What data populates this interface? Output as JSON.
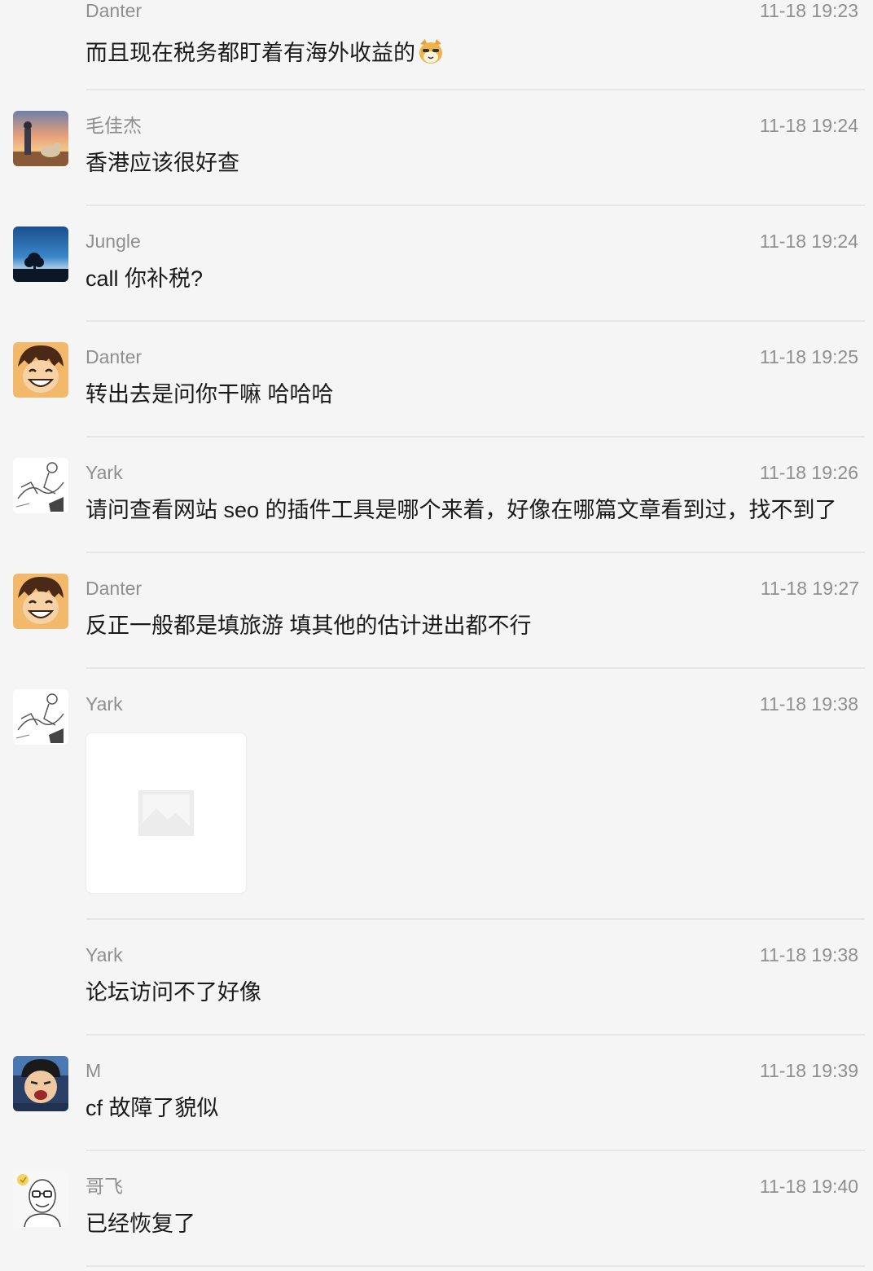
{
  "messages": [
    {
      "name": "Danter",
      "time": "11-18 19:23",
      "text": "而且现在税务都盯着有海外收益的",
      "emoji": "cat-face-emoji"
    },
    {
      "name": "毛佳杰",
      "time": "11-18 19:24",
      "text": "香港应该很好查",
      "avatar": "boy-with-dog-sunset-avatar"
    },
    {
      "name": "Jungle",
      "time": "11-18 19:24",
      "text": "call 你补税?",
      "avatar": "tree-at-dusk-avatar"
    },
    {
      "name": "Danter",
      "time": "11-18 19:25",
      "text": "转出去是问你干嘛 哈哈哈",
      "avatar": "smiling-anime-boy-avatar"
    },
    {
      "name": "Yark",
      "time": "11-18 19:26",
      "text": "请问查看网站 seo 的插件工具是哪个来着，好像在哪篇文章看到过，找不到了",
      "avatar": "sketch-drawing-avatar"
    },
    {
      "name": "Danter",
      "time": "11-18 19:27",
      "text": "反正一般都是填旅游 填其他的估计进出都不行",
      "avatar": "smiling-anime-boy-avatar"
    },
    {
      "name": "Yark",
      "time": "11-18 19:38",
      "image": "image-placeholder-icon",
      "avatar": "sketch-drawing-avatar"
    },
    {
      "name": "Yark",
      "time": "11-18 19:38",
      "text": "论坛访问不了好像"
    },
    {
      "name": "M",
      "time": "11-18 19:39",
      "text": "cf 故障了貌似",
      "avatar": "laughing-child-avatar"
    },
    {
      "name": "哥飞",
      "time": "11-18 19:40",
      "text": "已经恢复了",
      "avatar": "bald-man-with-glasses-avatar"
    }
  ],
  "colors": {
    "background": "#f5f5f5",
    "name_and_time": "#8f8f8f",
    "message_text": "#1a1a1a",
    "divider": "#e6e6e6"
  }
}
